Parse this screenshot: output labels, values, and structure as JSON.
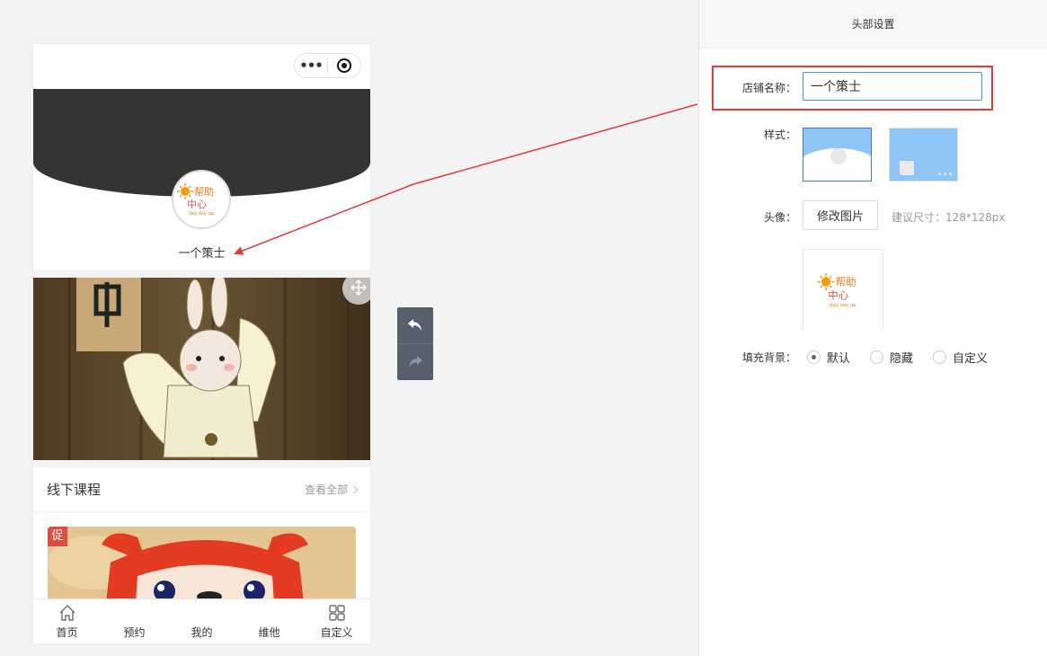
{
  "preview": {
    "shop_name": "一个策士",
    "logo_line1": "帮助",
    "logo_line2": "中心",
    "logo_line3": "day day up",
    "section_title": "线下课程",
    "see_all": "查看全部",
    "promo_badge": "促",
    "tabbar": [
      {
        "label": "首页",
        "icon": "home-icon"
      },
      {
        "label": "预约",
        "icon": ""
      },
      {
        "label": "我的",
        "icon": ""
      },
      {
        "label": "维他",
        "icon": ""
      },
      {
        "label": "自定义",
        "icon": "grid-icon"
      }
    ]
  },
  "history": {
    "undo_icon": "undo-icon",
    "redo_icon": "redo-icon"
  },
  "panel": {
    "title": "头部设置",
    "shop_name_label": "店铺名称：",
    "shop_name_value": "一个策士",
    "style_label": "样式：",
    "avatar_label": "头像：",
    "edit_image_button": "修改图片",
    "size_hint": "建议尺寸：128*128px",
    "fill_bg_label": "填充背景：",
    "fill_options": [
      {
        "label": "默认",
        "checked": true
      },
      {
        "label": "隐藏",
        "checked": false
      },
      {
        "label": "自定义",
        "checked": false
      }
    ]
  },
  "colors": {
    "header_dark": "#343434",
    "highlight_red": "#e03a3a",
    "input_focus": "#4a90d9",
    "style_blue": "#8ec4f6",
    "history_bg": "#54606b"
  }
}
